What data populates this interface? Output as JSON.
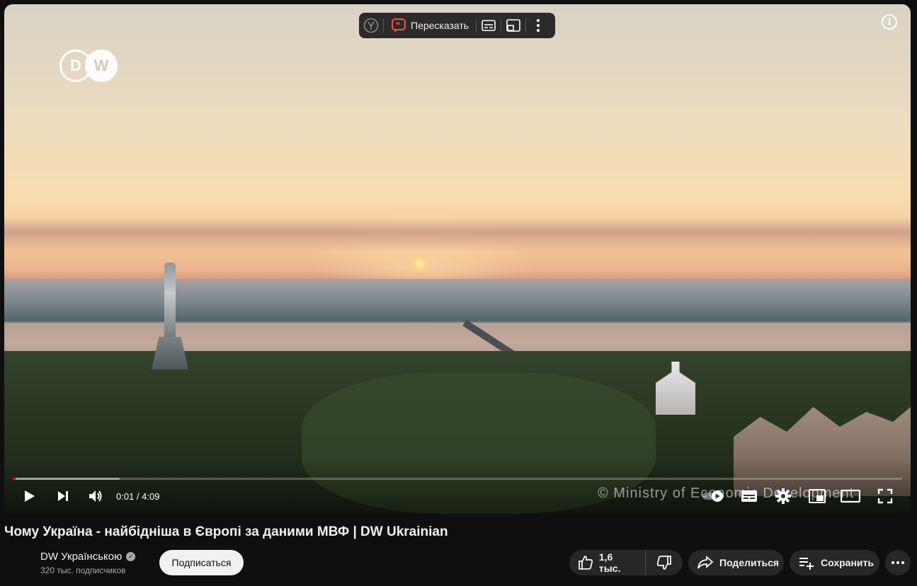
{
  "player": {
    "overlay_toolbar": {
      "retell_label": "Пересказать"
    },
    "watermark": "© Ministry of Economic Development",
    "logo_text": [
      "D",
      "W"
    ],
    "info_label": "i",
    "time_display": "0:01 / 4:09",
    "progress": {
      "played_fraction": 0.003,
      "loaded_fraction": 0.12
    }
  },
  "video": {
    "title": "Чому Україна - найбідніша в Європі за даними МВФ | DW Ukrainian"
  },
  "channel": {
    "name": "DW Українською",
    "subscribers": "320 тыс. подписчиков",
    "verified_mark": "✓",
    "subscribe_label": "Подписаться"
  },
  "actions": {
    "like_count": "1,6 тыс.",
    "share_label": "Поделиться",
    "save_label": "Сохранить"
  },
  "colors": {
    "background": "#0f0f0f",
    "progress_played": "#ff0000",
    "retell_accent": "#ff4d4d",
    "pill_bg": "#272727"
  }
}
